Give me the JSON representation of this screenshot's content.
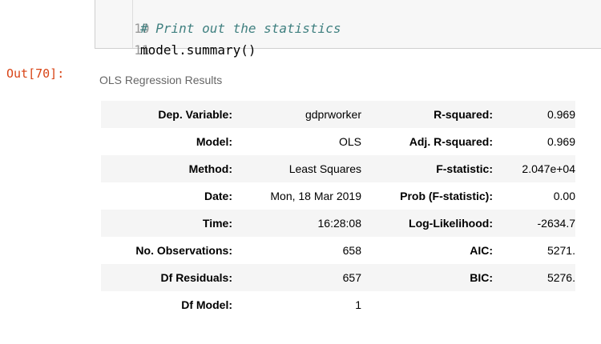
{
  "code_cell": {
    "lines": [
      {
        "number": "10",
        "text": "# Print out the statistics"
      },
      {
        "number": "11",
        "text": "model.summary()"
      }
    ]
  },
  "output": {
    "prompt": "Out[70]:",
    "title": "OLS Regression Results",
    "rows": [
      {
        "label1": "Dep. Variable:",
        "value1": "gdprworker",
        "label2": "R-squared:",
        "value2": "0.969"
      },
      {
        "label1": "Model:",
        "value1": "OLS",
        "label2": "Adj. R-squared:",
        "value2": "0.969"
      },
      {
        "label1": "Method:",
        "value1": "Least Squares",
        "label2": "F-statistic:",
        "value2": "2.047e+04"
      },
      {
        "label1": "Date:",
        "value1": "Mon, 18 Mar 2019",
        "label2": "Prob (F-statistic):",
        "value2": "0.00"
      },
      {
        "label1": "Time:",
        "value1": "16:28:08",
        "label2": "Log-Likelihood:",
        "value2": "-2634.7"
      },
      {
        "label1": "No. Observations:",
        "value1": "658",
        "label2": "AIC:",
        "value2": "5271."
      },
      {
        "label1": "Df Residuals:",
        "value1": "657",
        "label2": "BIC:",
        "value2": "5276."
      },
      {
        "label1": "Df Model:",
        "value1": "1",
        "label2": "",
        "value2": ""
      }
    ]
  },
  "colors": {
    "comment": "#408080",
    "out_prompt": "#d84315",
    "row_stripe": "#f5f5f5"
  }
}
